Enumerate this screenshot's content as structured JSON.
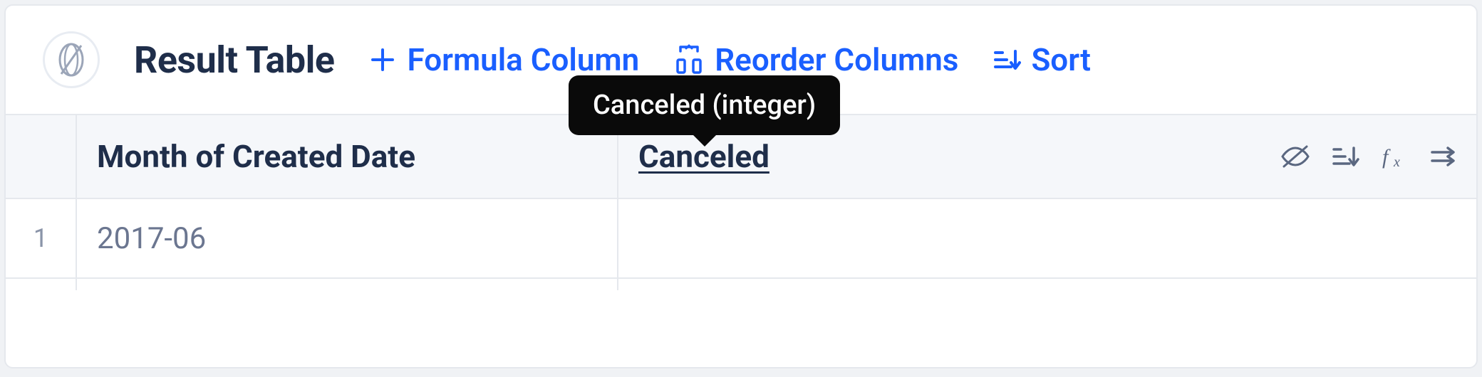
{
  "header": {
    "title": "Result Table",
    "actions": {
      "formula_column": "Formula Column",
      "reorder_columns": "Reorder Columns",
      "sort": "Sort"
    }
  },
  "tooltip": {
    "text": "Canceled (integer)"
  },
  "table": {
    "columns": [
      {
        "label": "Month of Created Date"
      },
      {
        "label": "Canceled"
      }
    ],
    "rows": [
      {
        "num": "1",
        "cells": [
          "2017-06",
          ""
        ]
      }
    ]
  }
}
